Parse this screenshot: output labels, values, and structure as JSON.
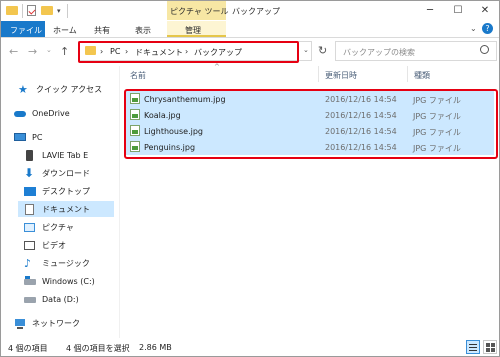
{
  "window": {
    "contextual_group": "ピクチャ ツール",
    "title": "バックアップ",
    "controls": {
      "minimize": "─",
      "maximize": "☐",
      "close": "✕"
    }
  },
  "ribbon": {
    "tabs": [
      "ファイル",
      "ホーム",
      "共有",
      "表示",
      "管理"
    ]
  },
  "address": {
    "crumbs": [
      "PC",
      "ドキュメント",
      "バックアップ"
    ],
    "separator": "›",
    "search_placeholder": "バックアップの検索"
  },
  "nav": [
    {
      "label": "クイック アクセス",
      "icon": "star-icon"
    },
    {
      "label": "OneDrive",
      "icon": "cloud-icon"
    },
    {
      "label": "PC",
      "icon": "computer-icon"
    },
    {
      "label": "LAVIE Tab E",
      "icon": "device-icon"
    },
    {
      "label": "ダウンロード",
      "icon": "download-icon"
    },
    {
      "label": "デスクトップ",
      "icon": "desktop-icon"
    },
    {
      "label": "ドキュメント",
      "icon": "documents-icon",
      "selected": true
    },
    {
      "label": "ピクチャ",
      "icon": "pictures-icon"
    },
    {
      "label": "ビデオ",
      "icon": "video-icon"
    },
    {
      "label": "ミュージック",
      "icon": "music-icon"
    },
    {
      "label": "Windows (C:)",
      "icon": "drive-icon"
    },
    {
      "label": "Data (D:)",
      "icon": "drive-icon"
    },
    {
      "label": "ネットワーク",
      "icon": "network-icon"
    }
  ],
  "columns": {
    "name": "名前",
    "modified": "更新日時",
    "type": "種類"
  },
  "files": [
    {
      "name": "Chrysanthemum.jpg",
      "modified": "2016/12/16 14:54",
      "type": "JPG ファイル"
    },
    {
      "name": "Koala.jpg",
      "modified": "2016/12/16 14:54",
      "type": "JPG ファイル"
    },
    {
      "name": "Lighthouse.jpg",
      "modified": "2016/12/16 14:54",
      "type": "JPG ファイル"
    },
    {
      "name": "Penguins.jpg",
      "modified": "2016/12/16 14:54",
      "type": "JPG ファイル"
    }
  ],
  "status": {
    "item_count": "4 個の項目",
    "selection": "4 個の項目を選択",
    "size": "2.86 MB"
  },
  "colors": {
    "accent": "#1979ca",
    "selection": "#cce8ff",
    "highlight": "#e60012",
    "contextual": "#f7e7a4"
  }
}
